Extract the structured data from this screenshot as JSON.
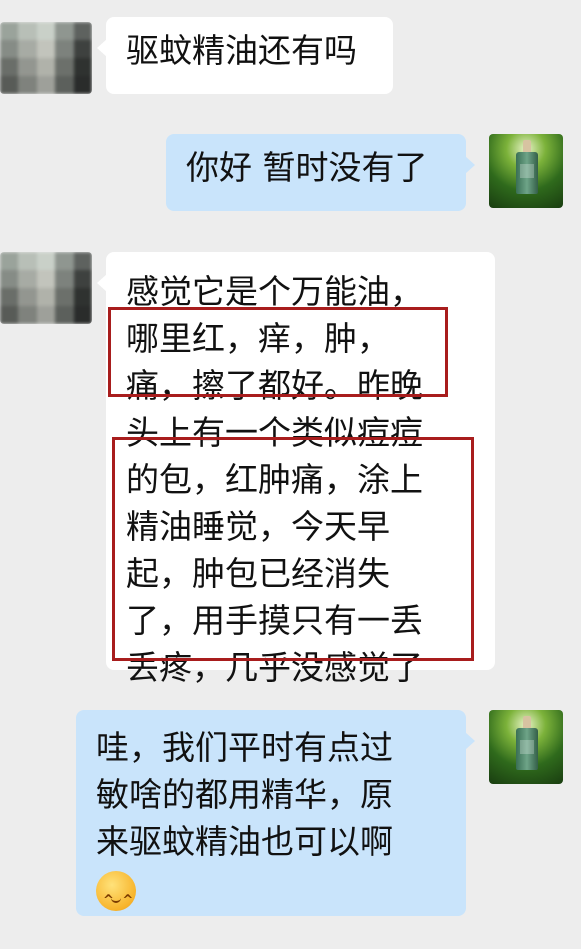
{
  "messages": [
    {
      "side": "left",
      "lines": [
        "驱蚊精油还有吗"
      ]
    },
    {
      "side": "right",
      "lines": [
        "你好 暂时没有了"
      ]
    },
    {
      "side": "left",
      "lines": [
        "感觉它是个万能油，",
        "哪里红，痒，肿，",
        "痛，擦了都好。昨晚",
        "头上有一个类似痘痘",
        "的包，红肿痛，涂上",
        "精油睡觉，今天早",
        "起，肿包已经消失",
        "了，用手摸只有一丢",
        "丢疼，几乎没感觉了"
      ]
    },
    {
      "side": "right",
      "lines": [
        "哇，我们平时有点过",
        "敏啥的都用精华，原",
        "来驱蚊精油也可以啊"
      ],
      "emoji": "smiling-face-emoji"
    }
  ],
  "avatars": {
    "contact": "blurred-contact-avatar",
    "self": "essential-oil-bottle-avatar"
  },
  "colors": {
    "background": "#ededed",
    "incoming_bubble": "#ffffff",
    "outgoing_bubble": "#c9e4fb",
    "highlight_border": "#a81d1d"
  }
}
